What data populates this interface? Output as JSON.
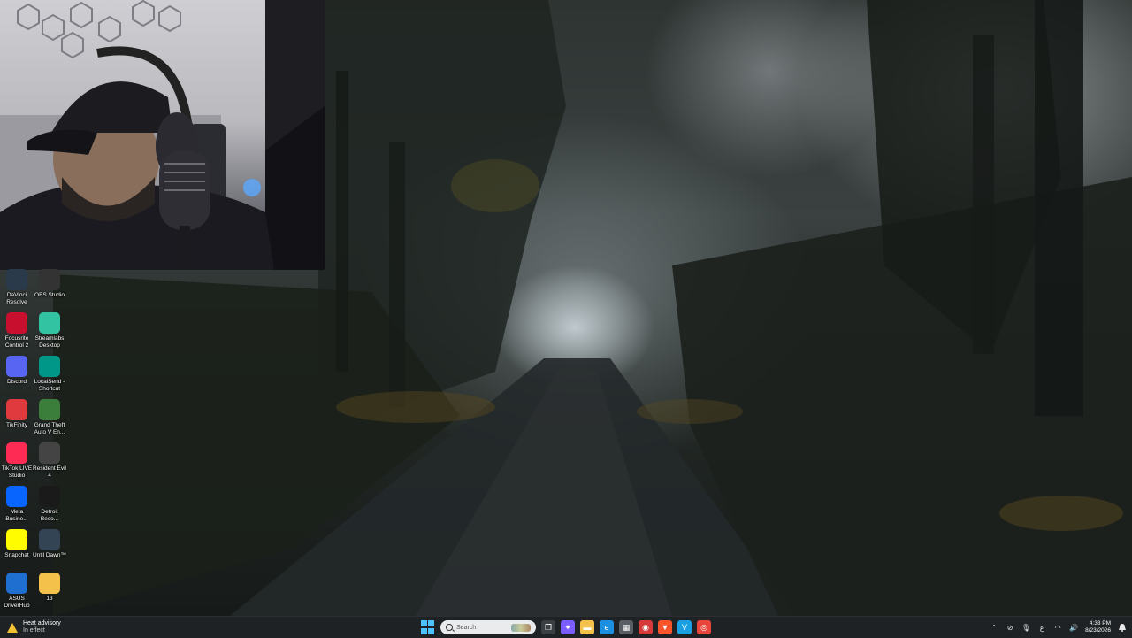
{
  "desktop_icons": [
    {
      "label": "DaVinci Resolve",
      "icon": "davinci-resolve-icon",
      "color": "#2b3a4a"
    },
    {
      "label": "OBS Studio",
      "icon": "obs-studio-icon",
      "color": "#333333"
    },
    {
      "label": "Focusrite Control 2",
      "icon": "focusrite-icon",
      "color": "#c8102e"
    },
    {
      "label": "Streamlabs Desktop",
      "icon": "streamlabs-icon",
      "color": "#31c3a2"
    },
    {
      "label": "Discord",
      "icon": "discord-icon",
      "color": "#5865f2"
    },
    {
      "label": "LocalSend - Shortcut",
      "icon": "localsend-icon",
      "color": "#009688"
    },
    {
      "label": "TikFinity",
      "icon": "tikfinity-icon",
      "color": "#e03a3e"
    },
    {
      "label": "Grand Theft Auto V En...",
      "icon": "gta-v-icon",
      "color": "#3b7d3b"
    },
    {
      "label": "TikTok LIVE Studio",
      "icon": "tiktok-live-icon",
      "color": "#fe2c55"
    },
    {
      "label": "Resident Evil 4",
      "icon": "resident-evil-icon",
      "color": "#444444"
    },
    {
      "label": "Meta Busine...",
      "icon": "meta-business-icon",
      "color": "#0866ff"
    },
    {
      "label": "Detroit Beco...",
      "icon": "detroit-icon",
      "color": "#1a1a1a"
    },
    {
      "label": "Snapchat",
      "icon": "snapchat-icon",
      "color": "#fffc00"
    },
    {
      "label": "Until Dawn™",
      "icon": "until-dawn-icon",
      "color": "#334455"
    },
    {
      "label": "ASUS DriverHub",
      "icon": "asus-driverhub-icon",
      "color": "#1f6fd1"
    },
    {
      "label": "13",
      "icon": "folder-icon",
      "color": "#f4c24a"
    }
  ],
  "taskbar": {
    "weather": {
      "title": "Heat advisory",
      "subtitle": "In effect"
    },
    "search_placeholder": "Search",
    "apps": [
      {
        "name": "task-view-icon",
        "color": "#3a3f44",
        "glyph": "❐"
      },
      {
        "name": "copilot-icon",
        "color": "#7b5cff",
        "glyph": "✦"
      },
      {
        "name": "file-explorer-icon",
        "color": "#f4c24a",
        "glyph": "▬"
      },
      {
        "name": "edge-icon",
        "color": "#1d8fe0",
        "glyph": "e"
      },
      {
        "name": "microsoft-store-icon",
        "color": "#5a5f66",
        "glyph": "▦"
      },
      {
        "name": "screen-recorder-icon",
        "color": "#d63a3a",
        "glyph": "◉"
      },
      {
        "name": "brave-icon",
        "color": "#fb542b",
        "glyph": "▼"
      },
      {
        "name": "vectorworks-icon",
        "color": "#1aa0e0",
        "glyph": "V"
      },
      {
        "name": "chrome-icon",
        "color": "#e8453c",
        "glyph": "◎"
      }
    ],
    "tray": {
      "language": "ع",
      "time": "4:33 PM",
      "date": "8/23/2026"
    }
  }
}
